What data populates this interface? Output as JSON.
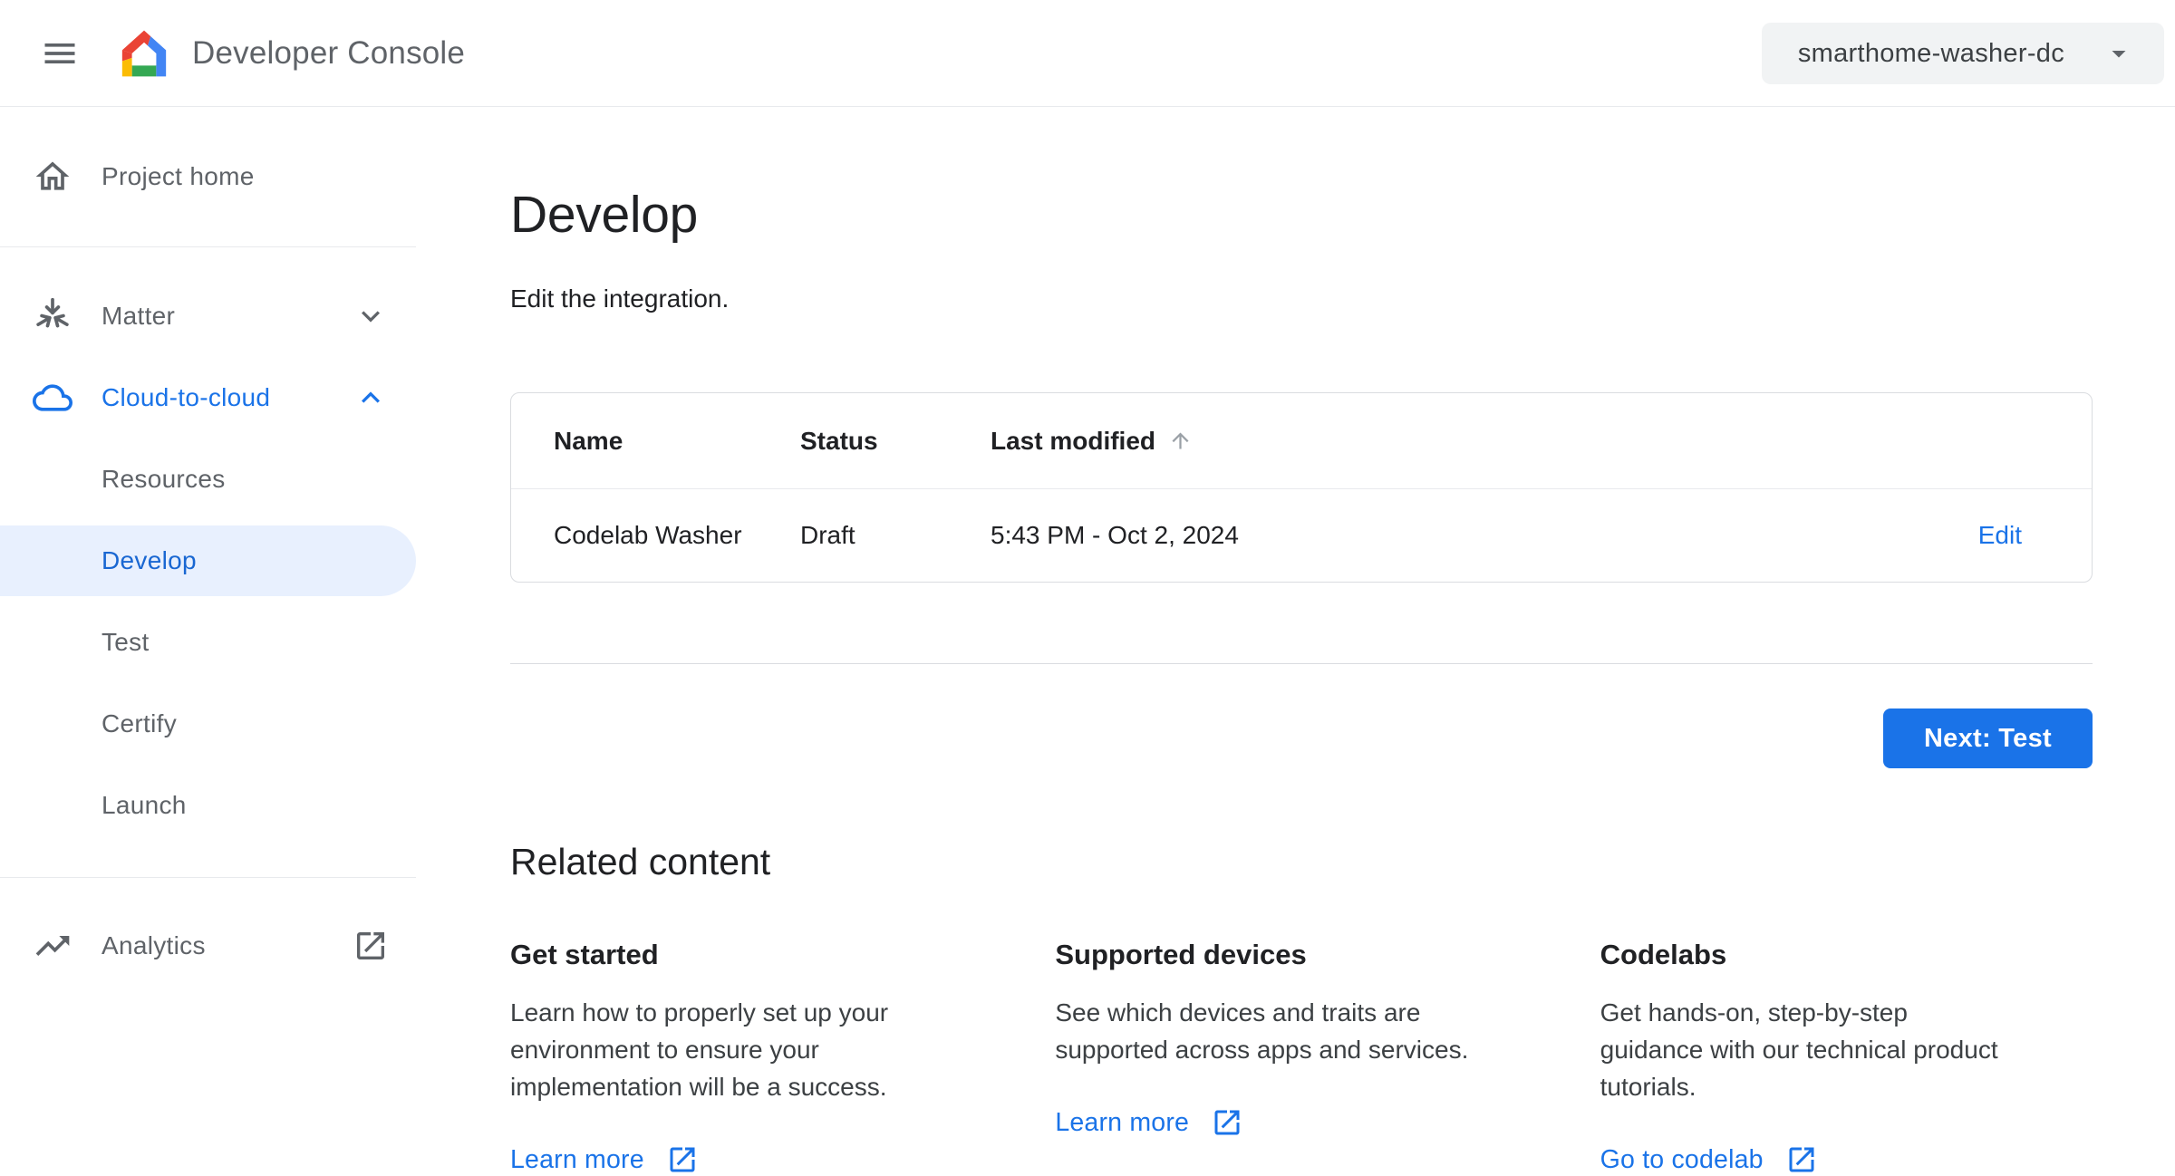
{
  "header": {
    "app_title": "Developer Console",
    "project_selector": {
      "value": "smarthome-washer-dc"
    }
  },
  "sidebar": {
    "project_home": "Project home",
    "matter": "Matter",
    "cloud_to_cloud": "Cloud-to-cloud",
    "cloud_items": [
      "Resources",
      "Develop",
      "Test",
      "Certify",
      "Launch"
    ],
    "active_item": "Develop",
    "analytics": "Analytics"
  },
  "main": {
    "title": "Develop",
    "subtitle": "Edit the integration.",
    "table": {
      "columns": [
        "Name",
        "Status",
        "Last modified"
      ],
      "sorted_by": "Last modified",
      "sort_direction": "ascending",
      "rows": [
        {
          "name": "Codelab Washer",
          "status": "Draft",
          "last_modified": "5:43 PM - Oct 2, 2024",
          "action": "Edit"
        }
      ]
    },
    "next_button": "Next: Test",
    "related": {
      "heading": "Related content",
      "cards": [
        {
          "title": "Get started",
          "body": "Learn how to properly set up your\nenvironment to ensure your\nimplementation will be a success.",
          "link": "Learn more"
        },
        {
          "title": "Supported devices",
          "body": "See which devices and traits are\nsupported across apps and services.",
          "link": "Learn more"
        },
        {
          "title": "Codelabs",
          "body": "Get hands-on, step-by-step\nguidance with our technical product\ntutorials.",
          "link": "Go to codelab"
        }
      ]
    }
  },
  "colors": {
    "link_blue": "#1a73e8",
    "active_nav_text": "#1967d2",
    "active_nav_bg": "#e8f0fe",
    "primary_button_bg": "#1a73e8",
    "chip_bg": "#f1f3f4",
    "divider": "#dadce0",
    "text_primary": "#202124",
    "text_secondary": "#5f6368",
    "logo_red": "#ea4335",
    "logo_blue": "#4285f4",
    "logo_yellow": "#fbbc04",
    "logo_green": "#34a853"
  },
  "icons": {
    "menu": "hamburger",
    "logo": "google-home",
    "dropdown": "caret-down",
    "home": "house-outline",
    "matter": "three-arrows-converging",
    "cloud": "cloud-outline",
    "chevron_down": "expand-more",
    "chevron_up": "expand-less",
    "trending": "trending-up",
    "external": "open-in-new",
    "sort": "arrow-upward"
  }
}
